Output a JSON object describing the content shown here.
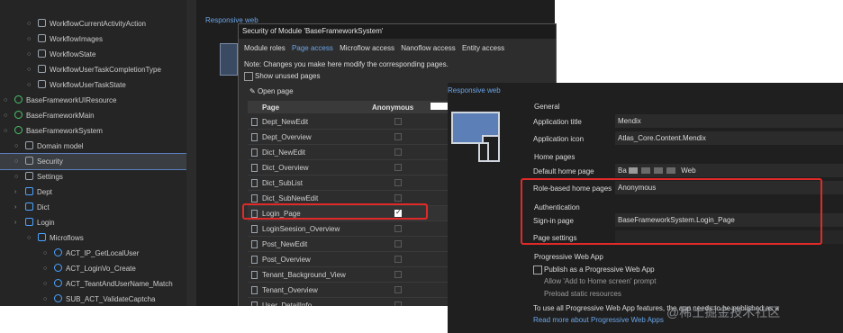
{
  "explorer": {
    "items": [
      {
        "label": "WorkflowCurrentActivityAction",
        "level": 3
      },
      {
        "label": "WorkflowImages",
        "level": 3
      },
      {
        "label": "WorkflowState",
        "level": 3
      },
      {
        "label": "WorkflowUserTaskCompletionType",
        "level": 3
      },
      {
        "label": "WorkflowUserTaskState",
        "level": 3
      },
      {
        "label": "BaseFrameworkUIResource",
        "level": 1
      },
      {
        "label": "BaseFrameworkMain",
        "level": 1
      },
      {
        "label": "BaseFrameworkSystem",
        "level": 1
      },
      {
        "label": "Domain model",
        "level": 2
      },
      {
        "label": "Security",
        "level": 2
      },
      {
        "label": "Settings",
        "level": 2
      },
      {
        "label": "Dept",
        "level": 2
      },
      {
        "label": "Dict",
        "level": 2
      },
      {
        "label": "Login",
        "level": 2
      },
      {
        "label": "Microflows",
        "level": 3
      },
      {
        "label": "ACT_IP_GetLocalUser",
        "level": 4
      },
      {
        "label": "ACT_LoginVo_Create",
        "level": 4
      },
      {
        "label": "ACT_TeantAndUserName_Match",
        "level": 4
      },
      {
        "label": "SUB_ACT_ValidateCaptcha",
        "level": 4
      }
    ]
  },
  "background_doc": {
    "tab_label": "Responsive web"
  },
  "dialog": {
    "title": "Security of Module 'BaseFrameworkSystem'",
    "tabs": [
      "Module roles",
      "Page access",
      "Microflow access",
      "Nanoflow access",
      "Entity access"
    ],
    "active_tab": "Page access",
    "note": "Note: Changes you make here modify the corresponding pages.",
    "show_unused": "Show unused pages",
    "open_page": "Open page",
    "col_page": "Page",
    "col_role": "Anonymous",
    "rows": [
      {
        "page": "Dept_NewEdit",
        "checked": false
      },
      {
        "page": "Dept_Overview",
        "checked": false
      },
      {
        "page": "Dict_NewEdit",
        "checked": false
      },
      {
        "page": "Dict_Overview",
        "checked": false
      },
      {
        "page": "Dict_SubList",
        "checked": false
      },
      {
        "page": "Dict_SubNewEdit",
        "checked": false
      },
      {
        "page": "Login_Page",
        "checked": true
      },
      {
        "page": "LoginSeesion_Overview",
        "checked": false
      },
      {
        "page": "Post_NewEdit",
        "checked": false
      },
      {
        "page": "Post_Overview",
        "checked": false
      },
      {
        "page": "Tenant_Background_View",
        "checked": false
      },
      {
        "page": "Tenant_Overview",
        "checked": false
      },
      {
        "page": "User_DetailInfo",
        "checked": false
      }
    ]
  },
  "settings": {
    "tab_label": "Responsive web",
    "general": "General",
    "app_title_label": "Application title",
    "app_title_value": "Mendix",
    "app_icon_label": "Application icon",
    "app_icon_value": "Atlas_Core.Content.Mendix",
    "home_pages": "Home pages",
    "default_home_label": "Default home page",
    "default_home_prefix": "Ba",
    "default_home_suffix": "Web",
    "role_home_label": "Role-based home pages",
    "role_home_value": "Anonymous",
    "authentication": "Authentication",
    "signin_label": "Sign-in page",
    "signin_value": "BaseFrameworkSystem.Login_Page",
    "page_settings_label": "Page settings",
    "pwa_header": "Progressive Web App",
    "pwa_publish": "Publish as a Progressive Web App",
    "pwa_allow": "Allow 'Add to Home screen' prompt",
    "pwa_preload": "Preload static resources",
    "pwa_note": "To use all Progressive Web App features, the app needs to be published as a",
    "pwa_link": "Read more about Progressive Web Apps"
  },
  "watermark": "@稀土掘金技术社区",
  "colors": {
    "accent": "#6aa5e8",
    "highlight": "#e02a2a",
    "panel": "#1f1f1f"
  }
}
